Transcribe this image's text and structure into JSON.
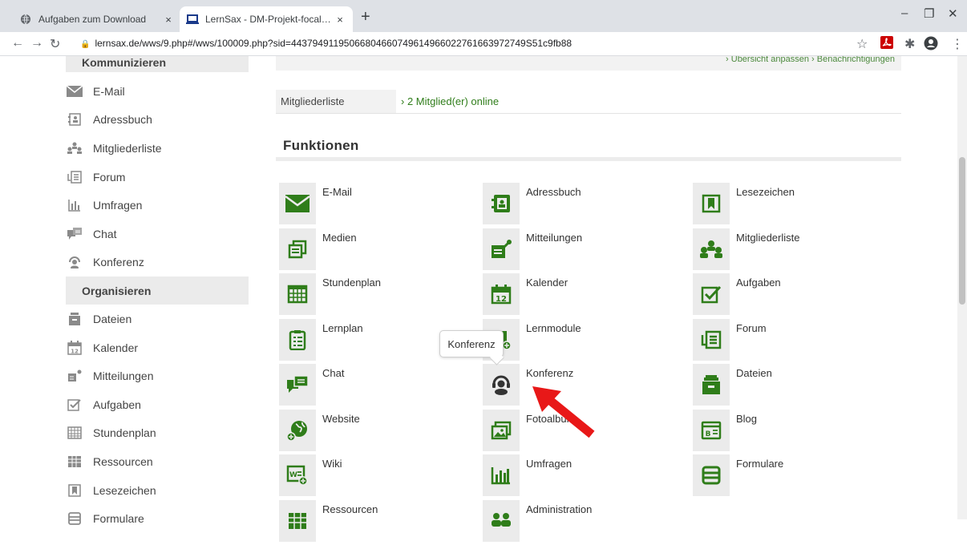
{
  "browser": {
    "tabs": [
      {
        "title": "Aufgaben zum Download",
        "active": false
      },
      {
        "title": "LernSax - DM-Projekt-focalpoint",
        "active": true
      }
    ],
    "url": "lernsax.de/wws/9.php#/wws/100009.php?sid=44379491195066804660749614966022761663972749S51c9fb88",
    "new_tab_icon": "+",
    "close_glyph": "×"
  },
  "sidebar": {
    "section1": "Kommunizieren",
    "items1": [
      {
        "label": "E-Mail",
        "icon": "mail-icon"
      },
      {
        "label": "Adressbuch",
        "icon": "addressbook-icon"
      },
      {
        "label": "Mitgliederliste",
        "icon": "members-icon"
      },
      {
        "label": "Forum",
        "icon": "forum-icon"
      },
      {
        "label": "Umfragen",
        "icon": "poll-icon"
      },
      {
        "label": "Chat",
        "icon": "chat-icon"
      },
      {
        "label": "Konferenz",
        "icon": "conference-icon"
      }
    ],
    "section2": "Organisieren",
    "items2": [
      {
        "label": "Dateien",
        "icon": "files-icon"
      },
      {
        "label": "Kalender",
        "icon": "calendar-icon"
      },
      {
        "label": "Mitteilungen",
        "icon": "notice-icon"
      },
      {
        "label": "Aufgaben",
        "icon": "tasks-icon"
      },
      {
        "label": "Stundenplan",
        "icon": "timetable-icon"
      },
      {
        "label": "Ressourcen",
        "icon": "resources-icon"
      },
      {
        "label": "Lesezeichen",
        "icon": "bookmark-icon"
      },
      {
        "label": "Formulare",
        "icon": "forms-icon"
      }
    ]
  },
  "main": {
    "top_links": "›  Übersicht anpassen   ›  Benachrichtigungen",
    "members_label": "Mitgliederliste",
    "members_value": "› 2 Mitglied(er) online",
    "heading": "Funktionen",
    "functions": [
      {
        "label": "E-Mail",
        "icon": "mail-icon"
      },
      {
        "label": "Adressbuch",
        "icon": "addressbook-icon"
      },
      {
        "label": "Lesezeichen",
        "icon": "bookmark-icon"
      },
      {
        "label": "Medien",
        "icon": "media-icon"
      },
      {
        "label": "Mitteilungen",
        "icon": "notice-icon"
      },
      {
        "label": "Mitgliederliste",
        "icon": "members-icon"
      },
      {
        "label": "Stundenplan",
        "icon": "timetable-icon"
      },
      {
        "label": "Kalender",
        "icon": "calendar-icon"
      },
      {
        "label": "Aufgaben",
        "icon": "tasks-icon"
      },
      {
        "label": "Lernplan",
        "icon": "learnplan-icon"
      },
      {
        "label": "Lernmodule",
        "icon": "modules-icon"
      },
      {
        "label": "Forum",
        "icon": "forum-icon"
      },
      {
        "label": "Chat",
        "icon": "chat-icon"
      },
      {
        "label": "Konferenz",
        "icon": "conference-icon"
      },
      {
        "label": "Dateien",
        "icon": "files-icon"
      },
      {
        "label": "Website",
        "icon": "website-icon"
      },
      {
        "label": "Fotoalbum",
        "icon": "photo-icon"
      },
      {
        "label": "Blog",
        "icon": "blog-icon"
      },
      {
        "label": "Wiki",
        "icon": "wiki-icon"
      },
      {
        "label": "Umfragen",
        "icon": "poll-icon"
      },
      {
        "label": "Formulare",
        "icon": "forms-icon"
      },
      {
        "label": "Ressourcen",
        "icon": "resources-icon"
      },
      {
        "label": "Administration",
        "icon": "admin-icon"
      }
    ],
    "tooltip": "Konferenz"
  },
  "colors": {
    "accent": "#2f7d1a",
    "tile": "#ebebeb",
    "sidebar_icon": "#8a8a8a",
    "arrow": "#e81818"
  }
}
